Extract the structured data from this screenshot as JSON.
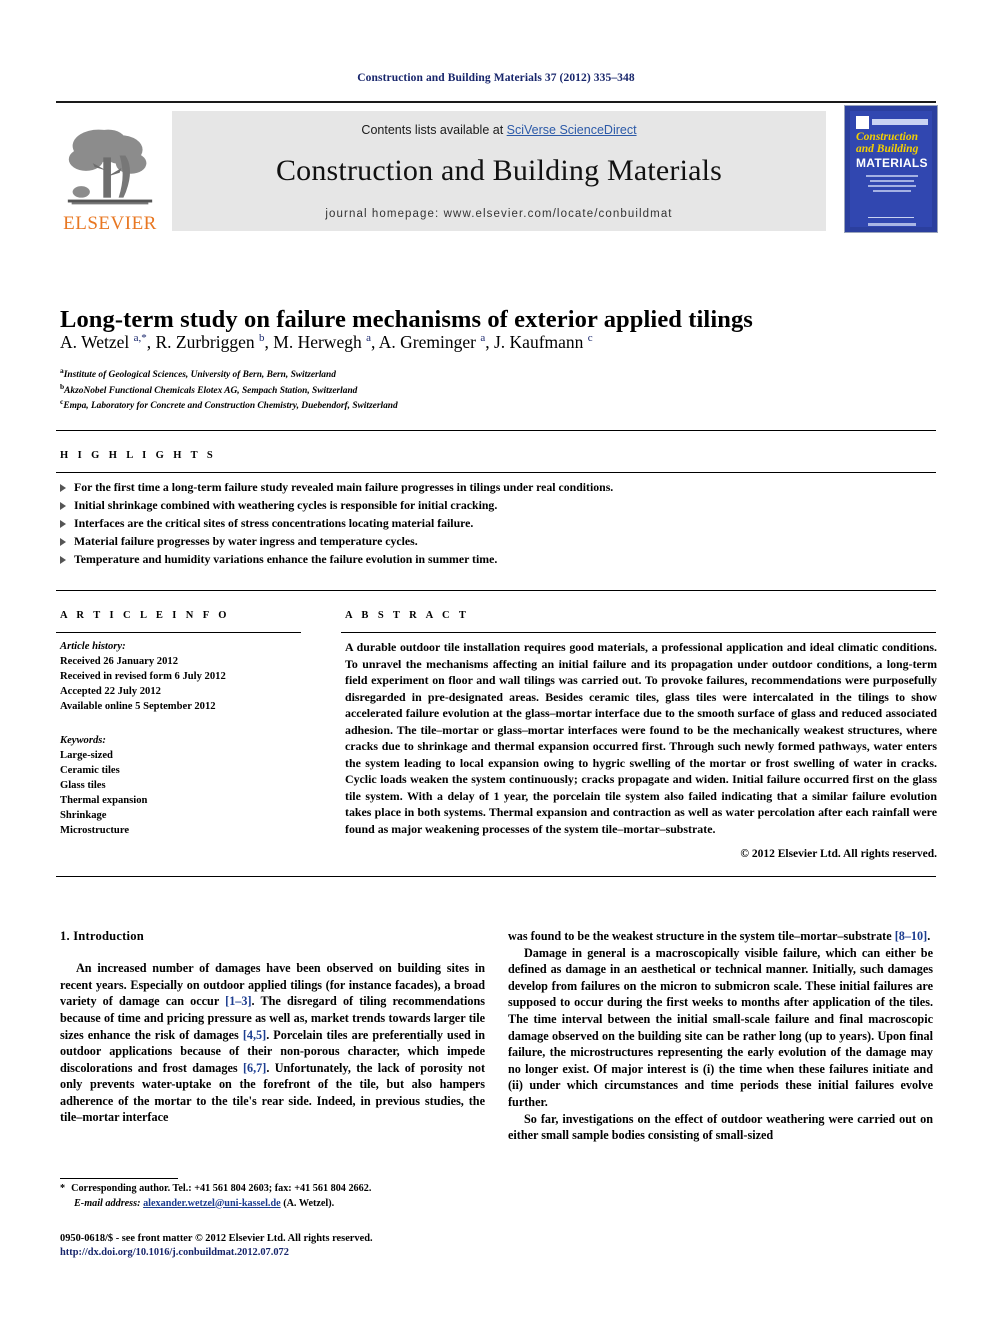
{
  "running_head": "Construction and Building Materials 37 (2012) 335–348",
  "masthead": {
    "publisher_name": "ELSEVIER",
    "contents_prefix": "Contents lists available at ",
    "contents_link": "SciVerse ScienceDirect",
    "journal_title": "Construction and Building Materials",
    "homepage": "journal homepage: www.elsevier.com/locate/conbuildmat",
    "cover": {
      "line1": "Construction",
      "line2": "and Building",
      "line3": "MATERIALS"
    }
  },
  "article": {
    "title": "Long-term study on failure mechanisms of exterior applied tilings",
    "authors_html": "A. Wetzel <sup>a,*</sup>, R. Zurbriggen <sup>b</sup>, M. Herwegh <sup>a</sup>, A. Greminger <sup>a</sup>, J. Kaufmann <sup>c</sup>",
    "affiliations": [
      {
        "marker": "a",
        "text": "Institute of Geological Sciences, University of Bern, Bern, Switzerland"
      },
      {
        "marker": "b",
        "text": "AkzoNobel Functional Chemicals Elotex AG, Sempach Station, Switzerland"
      },
      {
        "marker": "c",
        "text": "Empa, Laboratory for Concrete and Construction Chemistry, Duebendorf, Switzerland"
      }
    ]
  },
  "highlights": {
    "label": "H I G H L I G H T S",
    "items": [
      "For the first time a long-term failure study revealed main failure progresses in tilings under real conditions.",
      "Initial shrinkage combined with weathering cycles is responsible for initial cracking.",
      "Interfaces are the critical sites of stress concentrations locating material failure.",
      "Material failure progresses by water ingress and temperature cycles.",
      "Temperature and humidity variations enhance the failure evolution in summer time."
    ]
  },
  "article_info": {
    "label": "A R T I C L E    I N F O",
    "history_header": "Article history:",
    "history": [
      "Received 26 January 2012",
      "Received in revised form 6 July 2012",
      "Accepted 22 July 2012",
      "Available online 5 September 2012"
    ],
    "keywords_header": "Keywords:",
    "keywords": [
      "Large-sized",
      "Ceramic tiles",
      "Glass tiles",
      "Thermal expansion",
      "Shrinkage",
      "Microstructure"
    ]
  },
  "abstract": {
    "label": "A B S T R A C T",
    "text": "A durable outdoor tile installation requires good materials, a professional application and ideal climatic conditions. To unravel the mechanisms affecting an initial failure and its propagation under outdoor conditions, a long-term field experiment on floor and wall tilings was carried out. To provoke failures, recommendations were purposefully disregarded in pre-designated areas. Besides ceramic tiles, glass tiles were intercalated in the tilings to show accelerated failure evolution at the glass–mortar interface due to the smooth surface of glass and reduced associated adhesion. The tile–mortar or glass–mortar interfaces were found to be the mechanically weakest structures, where cracks due to shrinkage and thermal expansion occurred first. Through such newly formed pathways, water enters the system leading to local expansion owing to hygric swelling of the mortar or frost swelling of water in cracks. Cyclic loads weaken the system continuously; cracks propagate and widen. Initial failure occurred first on the glass tile system. With a delay of 1 year, the porcelain tile system also failed indicating that a similar failure evolution takes place in both systems. Thermal expansion and contraction as well as water percolation after each rainfall were found as major weakening processes of the system tile–mortar–substrate.",
    "copyright": "© 2012 Elsevier Ltd. All rights reserved."
  },
  "body": {
    "section_heading": "1. Introduction",
    "left_paragraphs": [
      "An increased number of damages have been observed on building sites in recent years. Especially on outdoor applied tilings (for instance facades), a broad variety of damage can occur [1–3]. The disregard of tiling recommendations because of time and pricing pressure as well as, market trends towards larger tile sizes enhance the risk of damages [4,5]. Porcelain tiles are preferentially used in outdoor applications because of their non-porous character, which impede discolorations and frost damages [6,7]. Unfortunately, the lack of porosity not only prevents water-uptake on the forefront of the tile, but also hampers adherence of the mortar to the tile's rear side. Indeed, in previous studies, the tile–mortar interface"
    ],
    "right_paragraphs": [
      "was found to be the weakest structure in the system tile–mortar–substrate [8–10].",
      "Damage in general is a macroscopically visible failure, which can either be defined as damage in an aesthetical or technical manner. Initially, such damages develop from failures on the micron to submicron scale. These initial failures are supposed to occur during the first weeks to months after application of the tiles. The time interval between the initial small-scale failure and final macroscopic damage observed on the building site can be rather long (up to years). Upon final failure, the microstructures representing the early evolution of the damage may no longer exist. Of major interest is (i) the time when these failures initiate and (ii) under which circumstances and time periods these initial failures evolve further.",
      "So far, investigations on the effect of outdoor weathering were carried out on either small sample bodies consisting of small-sized"
    ]
  },
  "footnote": {
    "star": "*",
    "corresponding": "Corresponding author. Tel.: +41 561 804 2603; fax: +41 561 804 2662.",
    "email_label": "E-mail address:",
    "email": "alexander.wetzel@uni-kassel.de",
    "email_suffix": "(A. Wetzel)."
  },
  "footer": {
    "issn_line": "0950-0618/$ - see front matter © 2012 Elsevier Ltd. All rights reserved.",
    "doi": "http://dx.doi.org/10.1016/j.conbuildmat.2012.07.072"
  }
}
